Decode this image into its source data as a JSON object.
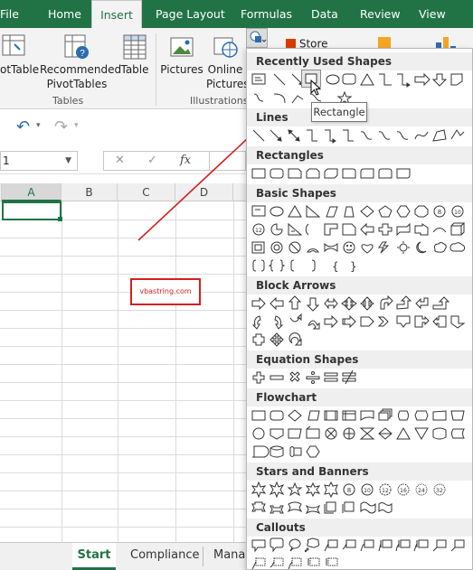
{
  "tabs": [
    {
      "label": "File",
      "active": false
    },
    {
      "label": "Home",
      "active": false
    },
    {
      "label": "Insert",
      "active": true
    },
    {
      "label": "Page Layout",
      "active": false
    },
    {
      "label": "Formulas",
      "active": false
    },
    {
      "label": "Data",
      "active": false
    },
    {
      "label": "Review",
      "active": false
    },
    {
      "label": "View",
      "active": false
    }
  ],
  "ribbon": {
    "pivottable": "otTable",
    "recommended_line1": "Recommended",
    "recommended_line2": "PivotTables",
    "table": "Table",
    "pictures": "Pictures",
    "online_line1": "Online",
    "online_line2": "Pictures",
    "store": "Store",
    "group_tables": "Tables",
    "group_illustrations": "Illustrations"
  },
  "formula_bar": {
    "name_box": "1",
    "cancel": "✕",
    "enter": "✓",
    "fx": "fx"
  },
  "grid": {
    "columns": [
      "A",
      "B",
      "C",
      "D"
    ],
    "selected_column": "A"
  },
  "watermark": "vbastring.com",
  "sheets": [
    {
      "label": "Start",
      "active": true
    },
    {
      "label": "Compliance",
      "active": false
    },
    {
      "label": "Mana",
      "active": false
    }
  ],
  "shapes_menu": {
    "sections": [
      "Recently Used Shapes",
      "Lines",
      "Rectangles",
      "Basic Shapes",
      "Block Arrows",
      "Equation Shapes",
      "Flowchart",
      "Stars and Banners",
      "Callouts"
    ],
    "tooltip": "Rectangle"
  },
  "colors": {
    "excel_green": "#217346",
    "annotation_red": "#d42020"
  }
}
